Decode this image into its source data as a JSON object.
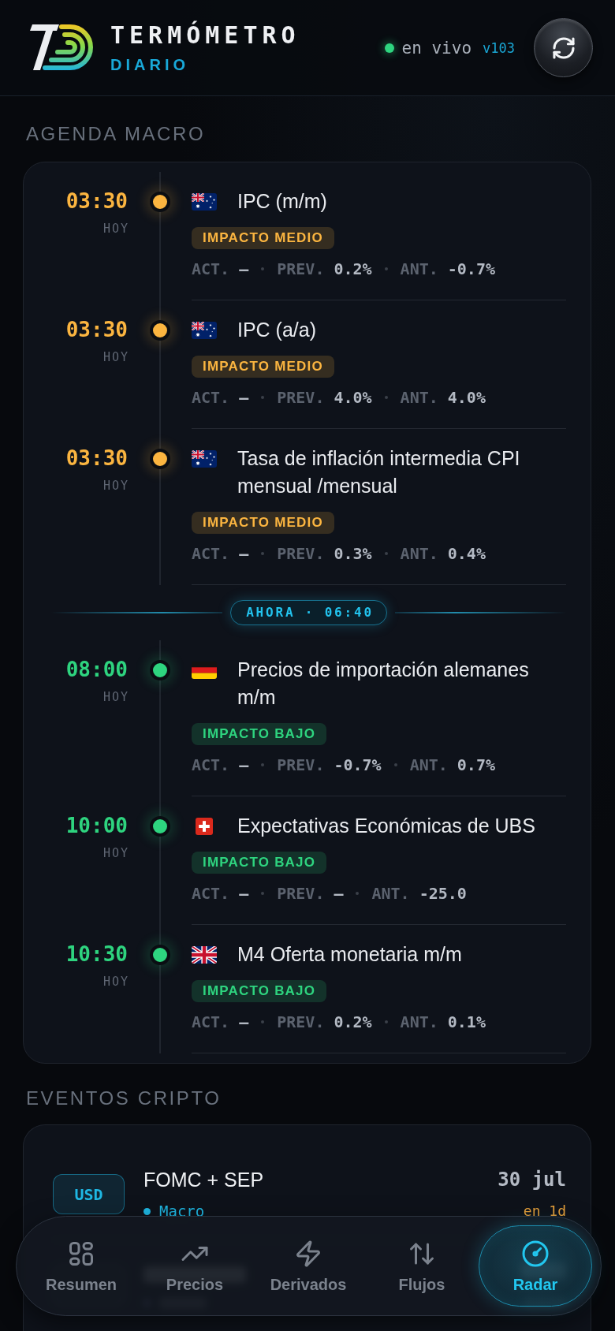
{
  "header": {
    "brand": {
      "title": "TERMÓMETRO",
      "subtitle": "DIARIO"
    },
    "status": {
      "live": true,
      "label": "en vivo",
      "version": "v103"
    }
  },
  "agenda_macro": {
    "title": "AGENDA MACRO",
    "timeline": [
      {
        "kind": "event",
        "time": "03:30",
        "day": "HOY",
        "flag": {
          "kind": "au"
        },
        "title": "IPC (m/m)",
        "color": "#fbb540",
        "impact_label": "IMPACTO MEDIO",
        "stats": [
          {
            "label": "ACT.",
            "value": "—"
          },
          {
            "label": "PREV.",
            "value": "0.2%"
          },
          {
            "label": "ANT.",
            "value": "-0.7%"
          }
        ]
      },
      {
        "kind": "event",
        "time": "03:30",
        "day": "HOY",
        "flag": {
          "kind": "au"
        },
        "title": "IPC (a/a)",
        "color": "#fbb540",
        "impact_label": "IMPACTO MEDIO",
        "stats": [
          {
            "label": "ACT.",
            "value": "—"
          },
          {
            "label": "PREV.",
            "value": "4.0%"
          },
          {
            "label": "ANT.",
            "value": "4.0%"
          }
        ]
      },
      {
        "kind": "event",
        "time": "03:30",
        "day": "HOY",
        "flag": {
          "kind": "au"
        },
        "title": "Tasa de inflación intermedia CPI mensual /mensual",
        "color": "#fbb540",
        "impact_label": "IMPACTO MEDIO",
        "stats": [
          {
            "label": "ACT.",
            "value": "—"
          },
          {
            "label": "PREV.",
            "value": "0.3%"
          },
          {
            "label": "ANT.",
            "value": "0.4%"
          }
        ]
      },
      {
        "kind": "now",
        "label": "AHORA · 06:40"
      },
      {
        "kind": "event",
        "time": "08:00",
        "day": "HOY",
        "flag": {
          "kind": "de"
        },
        "title": "Precios de importación alemanes m/m",
        "color": "#2ed47f",
        "impact_label": "IMPACTO BAJO",
        "stats": [
          {
            "label": "ACT.",
            "value": "—"
          },
          {
            "label": "PREV.",
            "value": "-0.7%"
          },
          {
            "label": "ANT.",
            "value": "0.7%"
          }
        ]
      },
      {
        "kind": "event",
        "time": "10:00",
        "day": "HOY",
        "flag": {
          "kind": "ch"
        },
        "title": "Expectativas Económicas de UBS",
        "color": "#2ed47f",
        "impact_label": "IMPACTO BAJO",
        "stats": [
          {
            "label": "ACT.",
            "value": "—"
          },
          {
            "label": "PREV.",
            "value": "—"
          },
          {
            "label": "ANT.",
            "value": "-25.0"
          }
        ]
      },
      {
        "kind": "event",
        "time": "10:30",
        "day": "HOY",
        "flag": {
          "kind": "gb"
        },
        "title": "M4 Oferta monetaria m/m",
        "color": "#2ed47f",
        "impact_label": "IMPACTO BAJO",
        "stats": [
          {
            "label": "ACT.",
            "value": "—"
          },
          {
            "label": "PREV.",
            "value": "0.2%"
          },
          {
            "label": "ANT.",
            "value": "0.1%"
          }
        ]
      }
    ]
  },
  "crypto_events": {
    "title": "EVENTOS CRIPTO",
    "items": [
      {
        "kind": "event",
        "ticker": "USD",
        "title": "FOMC + SEP",
        "category": "Macro",
        "color": "#1fb8e4",
        "date": "30 jul",
        "relative": "en 1d"
      },
      {
        "kind": "covered"
      }
    ]
  },
  "bottom_nav": [
    {
      "label": "Resumen",
      "selected": false
    },
    {
      "label": "Precios",
      "selected": false
    },
    {
      "label": "Derivados",
      "selected": false
    },
    {
      "label": "Flujos",
      "selected": false
    },
    {
      "label": "Radar",
      "selected": true
    }
  ]
}
